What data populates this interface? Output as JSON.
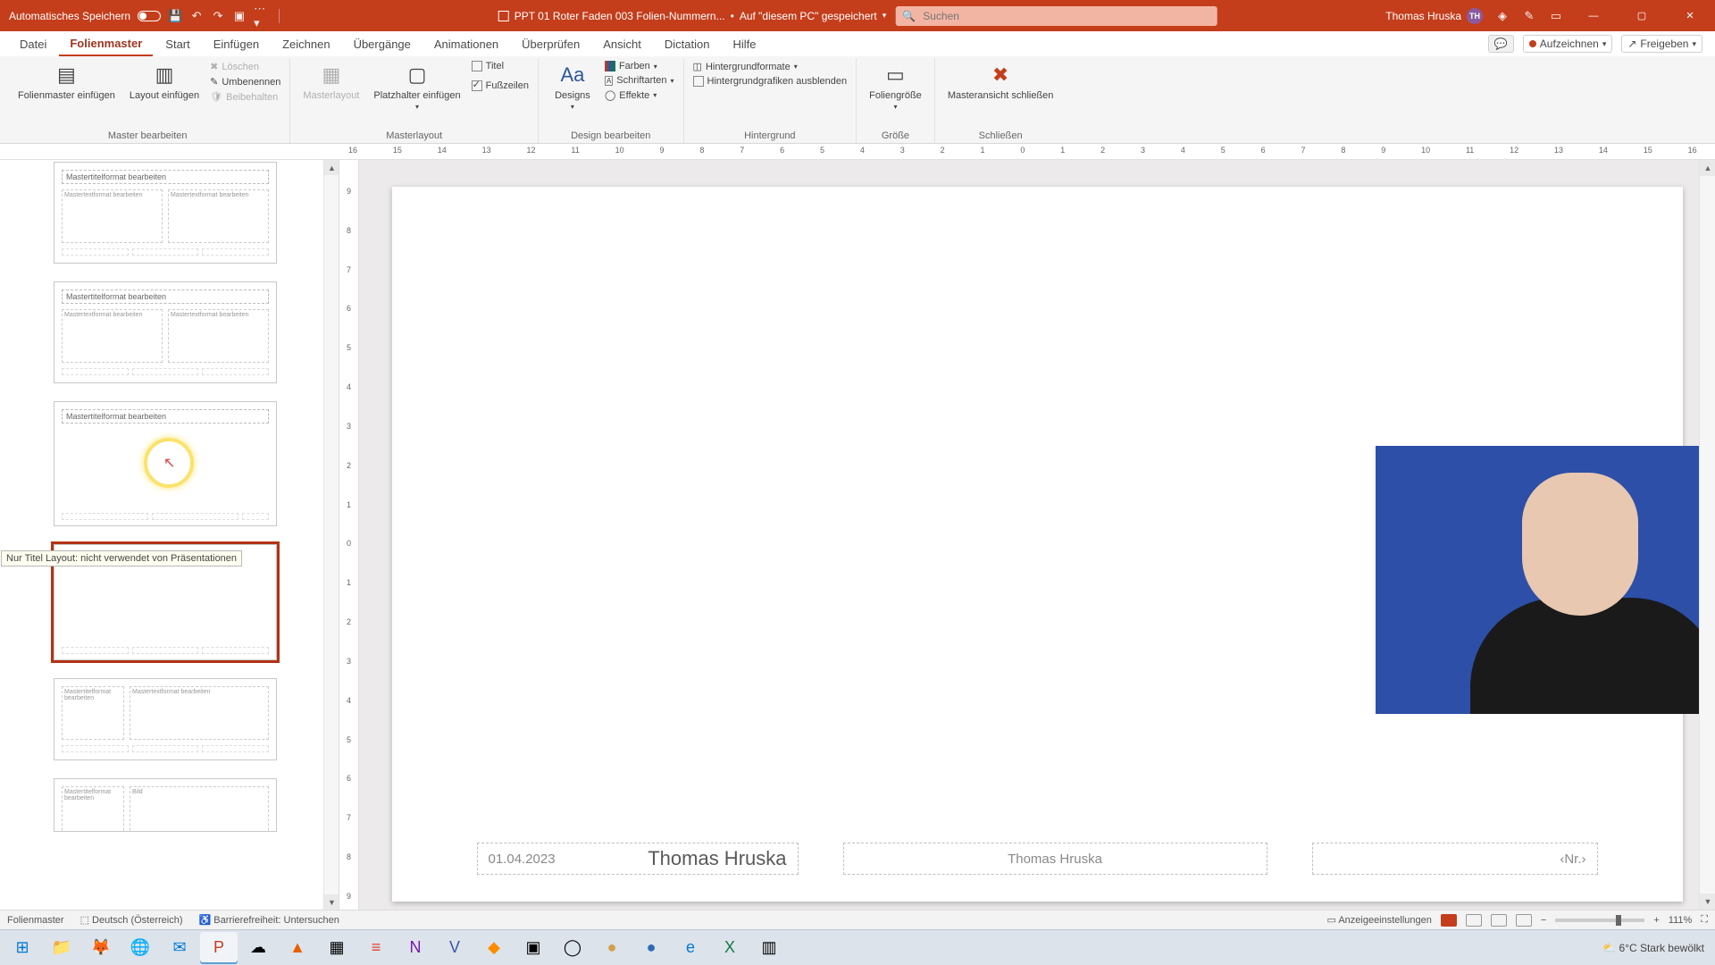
{
  "titlebar": {
    "autosave_label": "Automatisches Speichern",
    "doc_name": "PPT 01 Roter Faden 003 Folien-Nummern...",
    "save_location_prefix": "Auf \"diesem PC\" gespeichert",
    "search_placeholder": "Suchen",
    "user_name": "Thomas Hruska",
    "user_initials": "TH"
  },
  "tabs": {
    "items": [
      "Datei",
      "Folienmaster",
      "Start",
      "Einfügen",
      "Zeichnen",
      "Übergänge",
      "Animationen",
      "Überprüfen",
      "Ansicht",
      "Dictation",
      "Hilfe"
    ],
    "active_index": 1,
    "record_label": "Aufzeichnen",
    "share_label": "Freigeben"
  },
  "ribbon": {
    "group_master_edit": "Master bearbeiten",
    "group_masterlayout": "Masterlayout",
    "group_design_edit": "Design bearbeiten",
    "group_background": "Hintergrund",
    "group_size": "Größe",
    "group_close": "Schließen",
    "insert_master": "Folienmaster einfügen",
    "insert_layout": "Layout einfügen",
    "delete": "Löschen",
    "rename": "Umbenennen",
    "keep": "Beibehalten",
    "masterlayout_btn": "Masterlayout",
    "placeholder_insert": "Platzhalter einfügen",
    "chk_title": "Titel",
    "chk_footers": "Fußzeilen",
    "designs": "Designs",
    "colors": "Farben",
    "fonts": "Schriftarten",
    "effects": "Effekte",
    "bg_formats": "Hintergrundformate",
    "bg_hide": "Hintergrundgrafiken ausblenden",
    "slide_size": "Foliengröße",
    "close_master": "Masteransicht schließen"
  },
  "ruler": {
    "h": [
      "16",
      "15",
      "14",
      "13",
      "12",
      "11",
      "10",
      "9",
      "8",
      "7",
      "6",
      "5",
      "4",
      "3",
      "2",
      "1",
      "0",
      "1",
      "2",
      "3",
      "4",
      "5",
      "6",
      "7",
      "8",
      "9",
      "10",
      "11",
      "12",
      "13",
      "14",
      "15",
      "16"
    ],
    "v": [
      "9",
      "8",
      "7",
      "6",
      "5",
      "4",
      "3",
      "2",
      "1",
      "0",
      "1",
      "2",
      "3",
      "4",
      "5",
      "6",
      "7",
      "8",
      "9"
    ]
  },
  "thumbs": {
    "title_text": "Mastertitelformat bearbeiten",
    "content_text": "Mastertextformat bearbeiten",
    "tooltip": "Nur Titel Layout: nicht verwendet von Präsentationen"
  },
  "slide": {
    "date": "01.04.2023",
    "owner": "Thomas Hruska",
    "footer_center": "Thomas Hruska",
    "page_num": "‹Nr.›"
  },
  "status": {
    "mode": "Folienmaster",
    "lang": "Deutsch (Österreich)",
    "accessibility": "Barrierefreiheit: Untersuchen",
    "display_settings": "Anzeigeeinstellungen",
    "zoom": "111%"
  },
  "taskbar": {
    "weather_temp": "6°C",
    "weather_desc": "Stark bewölkt"
  }
}
